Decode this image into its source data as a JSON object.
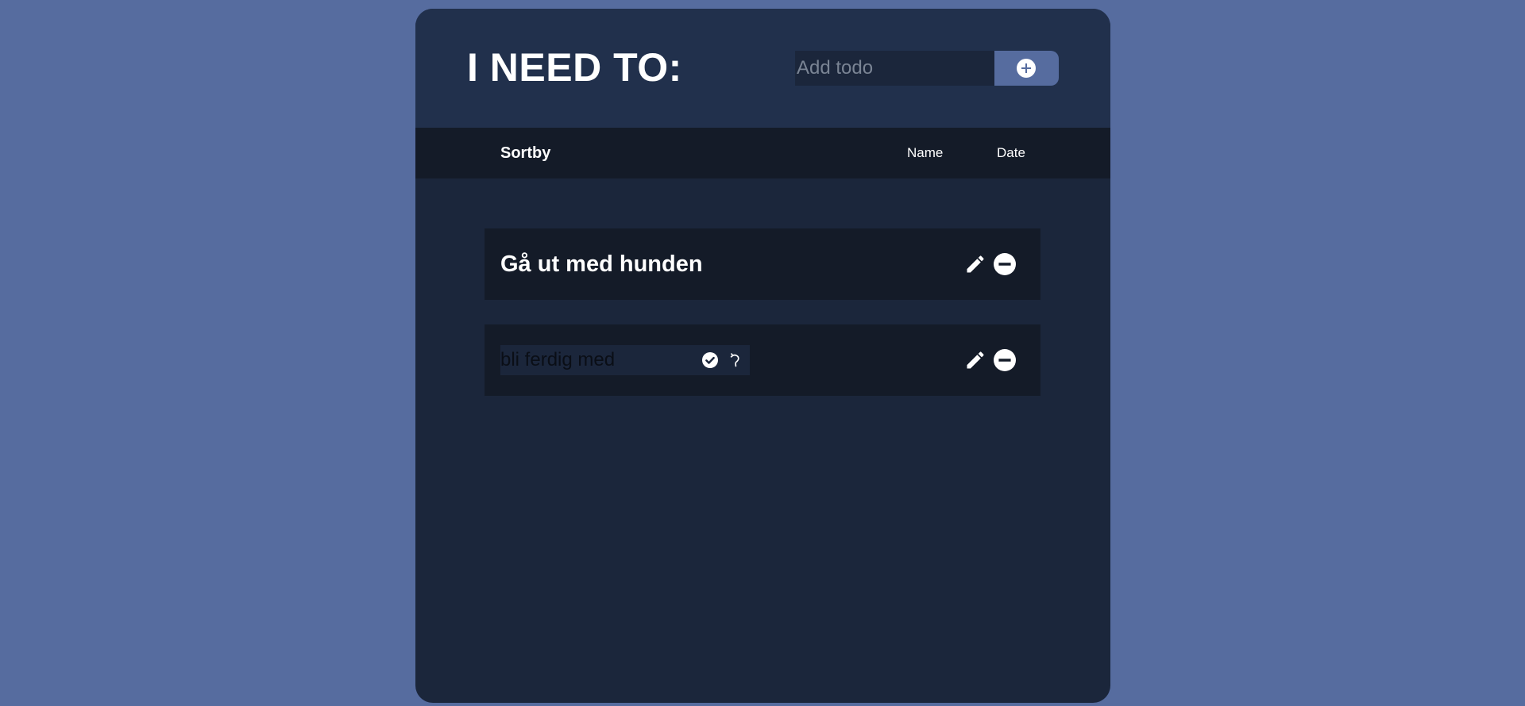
{
  "app": {
    "title": "I NEED TO:"
  },
  "add_form": {
    "placeholder": "Add todo",
    "value": "",
    "button_icon": "plus-circle-icon"
  },
  "sortbar": {
    "label": "Sortby",
    "options": [
      "Name",
      "Date"
    ]
  },
  "todos": [
    {
      "text": "Gå ut med hunden",
      "editing": false,
      "actions": [
        "edit-icon",
        "remove-icon"
      ]
    },
    {
      "text": "bli ferdig med",
      "editing": true,
      "edit_actions": [
        "confirm-icon",
        "undo-icon"
      ],
      "actions": [
        "edit-icon",
        "remove-icon"
      ]
    }
  ],
  "colors": {
    "page_background": "#566c9f",
    "card_background": "#1b263b",
    "header_background": "#21304c",
    "bar_background": "#141b28",
    "accent": "#566c9f",
    "text": "#ffffff"
  }
}
